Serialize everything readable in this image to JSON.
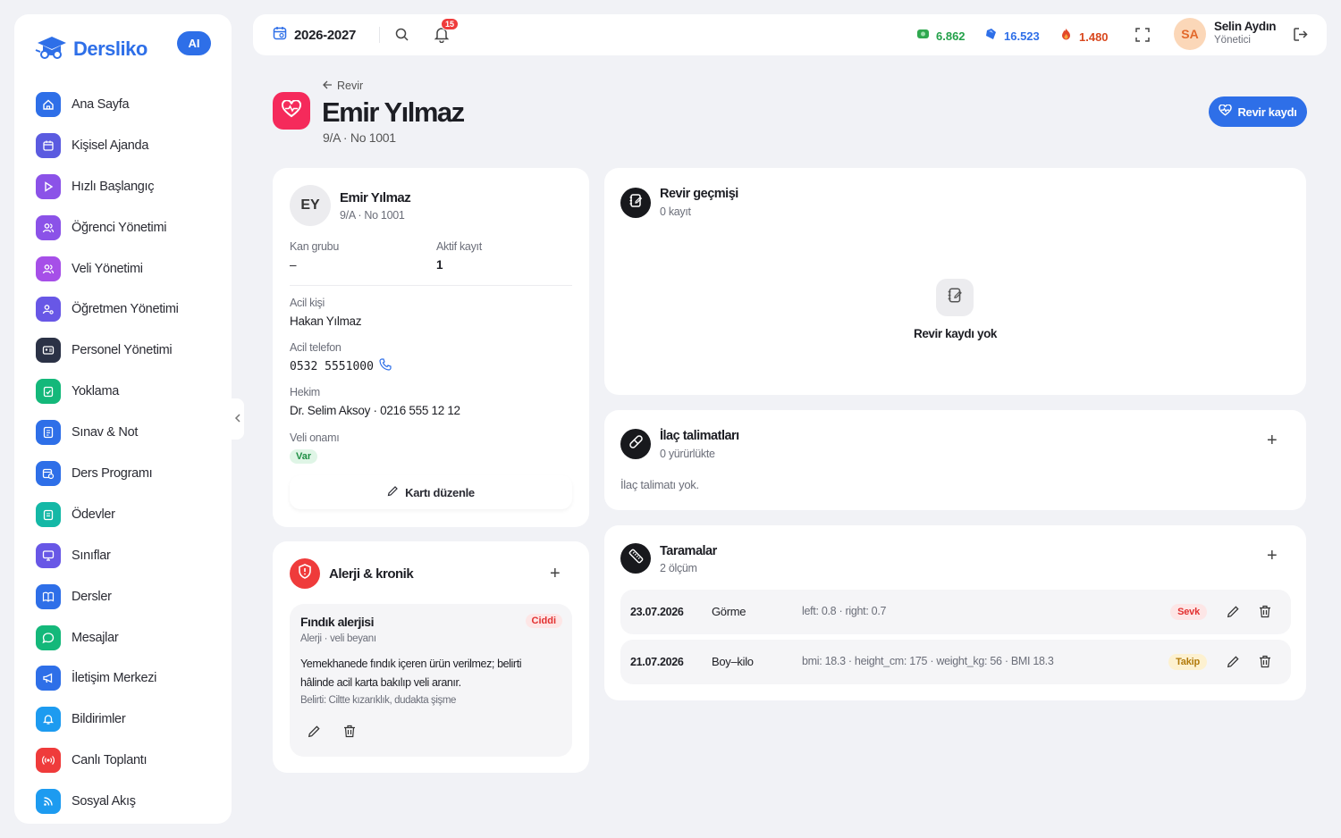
{
  "sidebar": {
    "brand": "Dersliko",
    "ai_badge": "AI",
    "items": [
      {
        "label": "Ana Sayfa",
        "icon": "home-icon",
        "color": "#2e6fe8"
      },
      {
        "label": "Kişisel Ajanda",
        "icon": "calendar-icon",
        "color": "#5b5be0"
      },
      {
        "label": "Hızlı Başlangıç",
        "icon": "play-icon",
        "color": "#8b52e8"
      },
      {
        "label": "Öğrenci Yönetimi",
        "icon": "users-icon",
        "color": "#8b52e8"
      },
      {
        "label": "Veli Yönetimi",
        "icon": "users-icon",
        "color": "#a64fe8"
      },
      {
        "label": "Öğretmen Yönetimi",
        "icon": "user-settings-icon",
        "color": "#6857e6"
      },
      {
        "label": "Personel Yönetimi",
        "icon": "id-card-icon",
        "color": "#2b3246"
      },
      {
        "label": "Yoklama",
        "icon": "clipboard-check-icon",
        "color": "#14b87a"
      },
      {
        "label": "Sınav & Not",
        "icon": "exam-icon",
        "color": "#2e6fe8"
      },
      {
        "label": "Ders Programı",
        "icon": "calendar-clock-icon",
        "color": "#2e6fe8"
      },
      {
        "label": "Ödevler",
        "icon": "clipboard-list-icon",
        "color": "#14b8a6"
      },
      {
        "label": "Sınıflar",
        "icon": "monitor-icon",
        "color": "#6857e6"
      },
      {
        "label": "Dersler",
        "icon": "book-icon",
        "color": "#2e6fe8"
      },
      {
        "label": "Mesajlar",
        "icon": "chat-icon",
        "color": "#14b87a"
      },
      {
        "label": "İletişim Merkezi",
        "icon": "megaphone-icon",
        "color": "#2e6fe8"
      },
      {
        "label": "Bildirimler",
        "icon": "bell-icon",
        "color": "#1d9bf0"
      },
      {
        "label": "Canlı Toplantı",
        "icon": "broadcast-icon",
        "color": "#ef3b3b"
      },
      {
        "label": "Sosyal Akış",
        "icon": "rss-icon",
        "color": "#1d9bf0"
      }
    ]
  },
  "topbar": {
    "year": "2026-2027",
    "notif_count": "15",
    "stat_green": "6.862",
    "stat_blue": "16.523",
    "stat_red": "1.480",
    "user_initials": "SA",
    "user_name": "Selin Aydın",
    "user_role": "Yönetici"
  },
  "header": {
    "back": "Revir",
    "title": "Emir Yılmaz",
    "subtitle": "9/A · No 1001",
    "action": "Revir kaydı"
  },
  "profile": {
    "initials": "EY",
    "name": "Emir Yılmaz",
    "class": "9/A · No 1001",
    "blood_label": "Kan grubu",
    "blood_value": "–",
    "active_label": "Aktif kayıt",
    "active_value": "1",
    "contact_label": "Acil kişi",
    "contact_value": "Hakan Yılmaz",
    "phone_label": "Acil telefon",
    "phone_value": "0532 5551000",
    "doctor_label": "Hekim",
    "doctor_value": "Dr. Selim Aksoy · 0216 555 12 12",
    "consent_label": "Veli onamı",
    "consent_value": "Var",
    "edit": "Kartı düzenle"
  },
  "allergy": {
    "title": "Alerji & kronik",
    "item_title": "Fındık alerjisi",
    "item_sub": "Alerji · veli beyanı",
    "item_badge": "Ciddi",
    "item_desc": "Yemekhanede fındık içeren ürün verilmez; belirti hâlinde acil karta bakılıp veli aranır.",
    "item_symptom": "Belirti: Ciltte kızarıklık, dudakta şişme"
  },
  "history": {
    "title": "Revir geçmişi",
    "sub": "0 kayıt",
    "empty": "Revir kaydı yok"
  },
  "meds": {
    "title": "İlaç talimatları",
    "sub": "0 yürürlükte",
    "empty": "İlaç talimatı yok."
  },
  "screenings": {
    "title": "Taramalar",
    "sub": "2 ölçüm",
    "rows": [
      {
        "date": "23.07.2026",
        "type": "Görme",
        "detail": "left: 0.8 · right: 0.7",
        "badge": "Sevk"
      },
      {
        "date": "21.07.2026",
        "type": "Boy–kilo",
        "detail": "bmi: 18.3 · height_cm: 175 · weight_kg: 56 · BMI 18.3",
        "badge": "Takip"
      }
    ]
  }
}
